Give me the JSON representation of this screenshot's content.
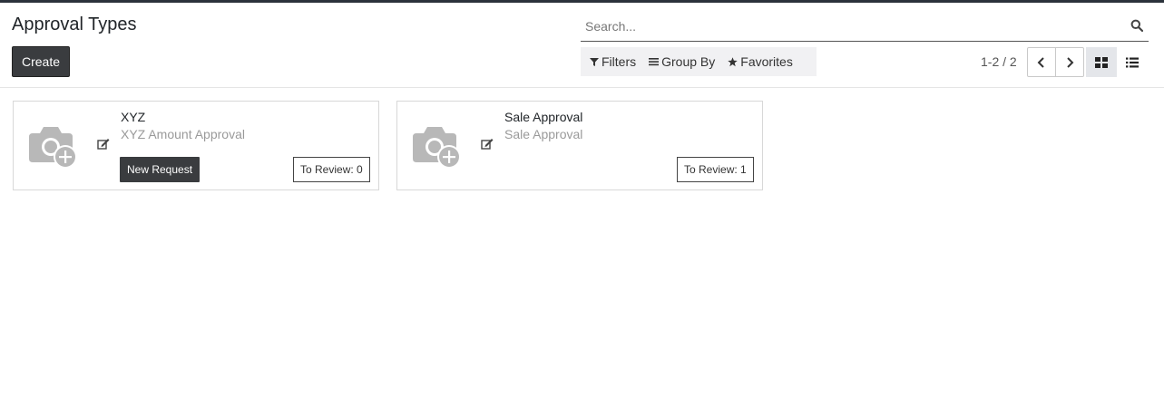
{
  "header": {
    "title": "Approval Types",
    "create_label": "Create"
  },
  "search": {
    "placeholder": "Search..."
  },
  "filters": {
    "filters_label": "Filters",
    "group_by_label": "Group By",
    "favorites_label": "Favorites"
  },
  "pager": {
    "value": "1-2 / 2"
  },
  "view_switcher": {
    "active": "kanban",
    "icons": [
      "kanban-icon",
      "list-icon"
    ]
  },
  "cards": [
    {
      "name": "XYZ",
      "description": "XYZ Amount Approval",
      "new_request_label": "New Request",
      "to_review": "To Review: 0"
    },
    {
      "name": "Sale Approval",
      "description": "Sale Approval",
      "to_review": "To Review: 1"
    }
  ],
  "colors": {
    "dark_button": "#3a3c3f",
    "top_strip": "#2b323b",
    "filter_bar_bg": "#f1f1f3",
    "muted_text": "#9a9a9a"
  }
}
